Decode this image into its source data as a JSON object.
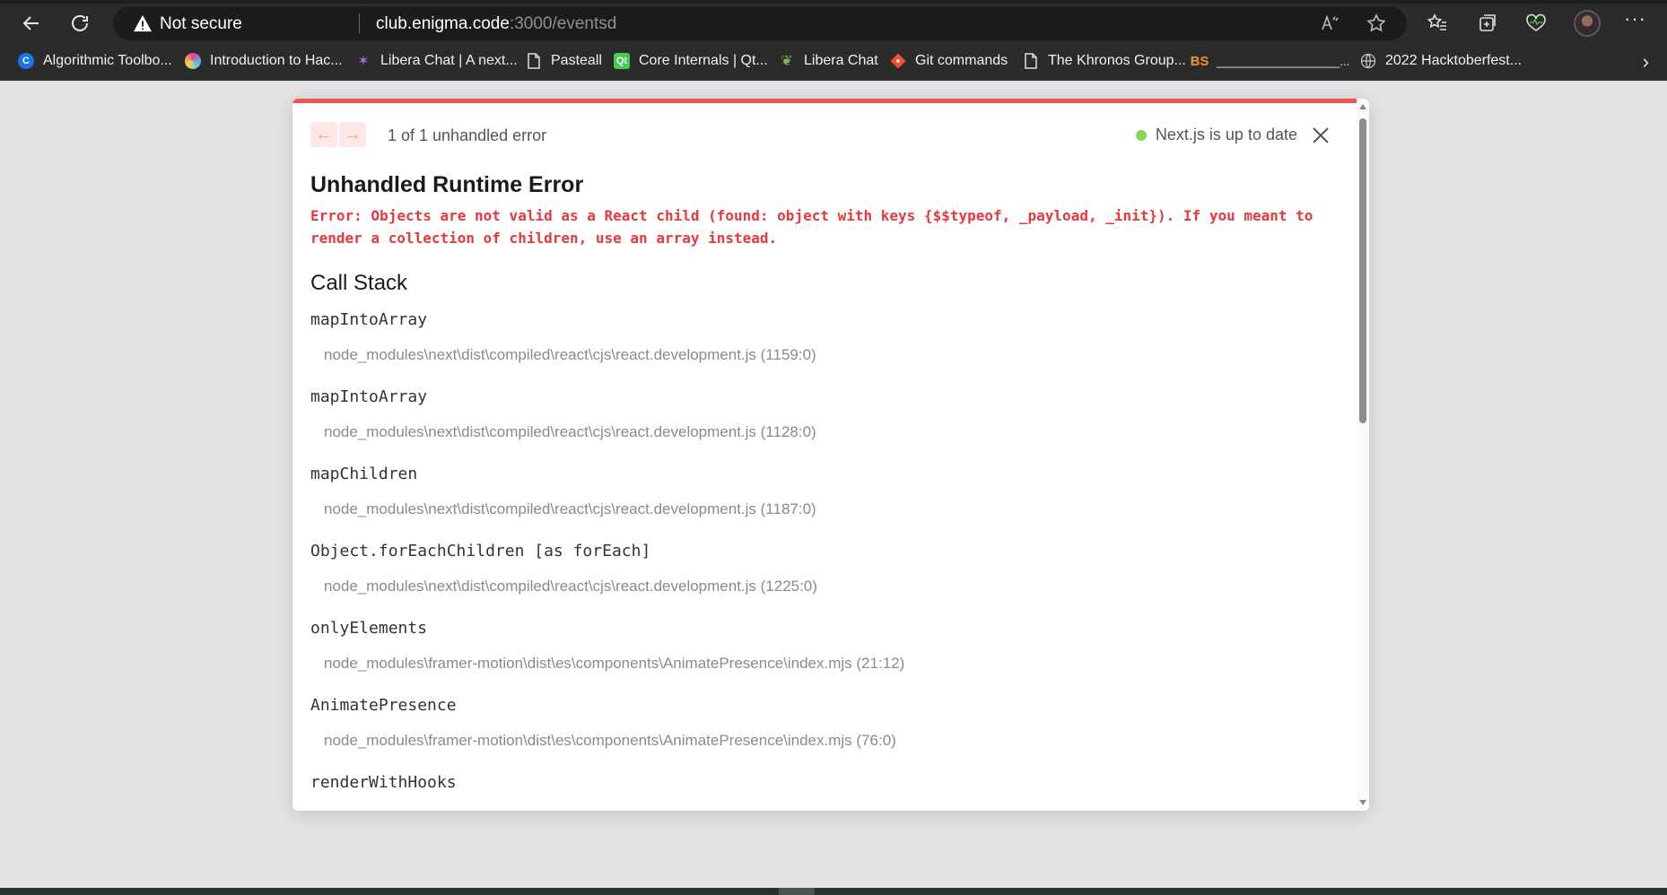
{
  "browser": {
    "not_secure": "Not secure",
    "url_host": "club.enigma.code",
    "url_rest": ":3000/eventsd",
    "read_aloud": "Á",
    "bookmarks": [
      {
        "label": "Algorithmic Toolbo...",
        "icon_text": "C",
        "icon_color": "#1a73e8"
      },
      {
        "label": "Introduction to Hac...",
        "icon_text": "",
        "icon_color": "#e53e9a"
      },
      {
        "label": "Libera Chat | A next...",
        "icon_text": "",
        "icon_color": "#8e44ad"
      },
      {
        "label": "Pasteall",
        "icon_text": "",
        "icon_color": "#dddddd"
      },
      {
        "label": "Core Internals | Qt...",
        "icon_text": "Qt",
        "icon_color": "#41cd52"
      },
      {
        "label": "Libera Chat",
        "icon_text": "",
        "icon_color": "#7ab648"
      },
      {
        "label": "Git commands",
        "icon_text": "",
        "icon_color": "#f05033"
      },
      {
        "label": "The Khronos Group...",
        "icon_text": "",
        "icon_color": "#dddddd"
      },
      {
        "label": "___________________...",
        "icon_text": "BS",
        "icon_color": "#f0932b"
      },
      {
        "label": "2022 Hacktoberfest...",
        "icon_text": "",
        "icon_color": "#bbbbbb"
      }
    ]
  },
  "overlay": {
    "counter": "1 of 1 unhandled error",
    "status": "Next.js is up to date",
    "title": "Unhandled Runtime Error",
    "message": "Error: Objects are not valid as a React child (found: object with keys {$$typeof, _payload, _init}). If you meant to render a collection of children, use an array instead.",
    "call_stack_title": "Call Stack",
    "frames": [
      {
        "fn": "mapIntoArray",
        "loc": "node_modules\\next\\dist\\compiled\\react\\cjs\\react.development.js (1159:0)"
      },
      {
        "fn": "mapIntoArray",
        "loc": "node_modules\\next\\dist\\compiled\\react\\cjs\\react.development.js (1128:0)"
      },
      {
        "fn": "mapChildren",
        "loc": "node_modules\\next\\dist\\compiled\\react\\cjs\\react.development.js (1187:0)"
      },
      {
        "fn": "Object.forEachChildren [as forEach]",
        "loc": "node_modules\\next\\dist\\compiled\\react\\cjs\\react.development.js (1225:0)"
      },
      {
        "fn": "onlyElements",
        "loc": "node_modules\\framer-motion\\dist\\es\\components\\AnimatePresence\\index.mjs (21:12)"
      },
      {
        "fn": "AnimatePresence",
        "loc": "node_modules\\framer-motion\\dist\\es\\components\\AnimatePresence\\index.mjs (76:0)"
      },
      {
        "fn": "renderWithHooks",
        "loc": ""
      }
    ]
  },
  "colors": {
    "error_red": "#e8383d",
    "accent_bar": "#ef5350",
    "status_dot": "#7ed957"
  }
}
